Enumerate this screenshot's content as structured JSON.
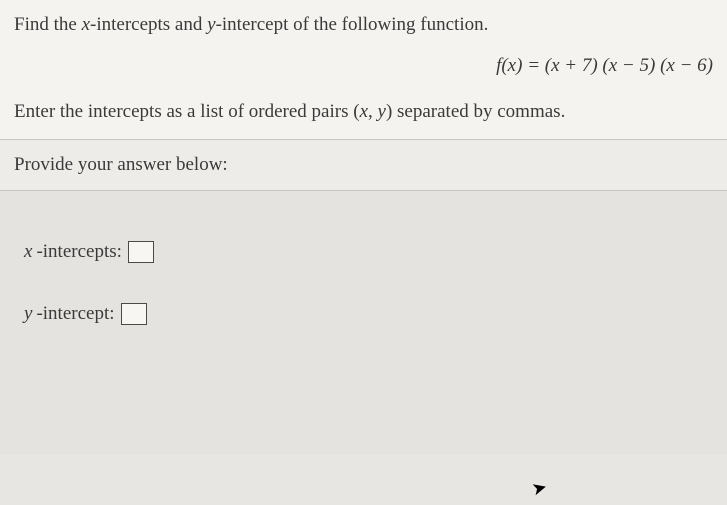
{
  "question": {
    "prompt_prefix": "Find the ",
    "x_var": "x",
    "prompt_mid1": "-intercepts and ",
    "y_var": "y",
    "prompt_mid2": "-intercept of the following function.",
    "equation_lhs": "f(x) = ",
    "equation_rhs": "(x + 7) (x − 5) (x − 6)",
    "instruction_prefix": "Enter the intercepts as a list of ordered pairs (",
    "pair_x": "x",
    "pair_sep": ", ",
    "pair_y": "y",
    "instruction_suffix": ") separated by commas."
  },
  "answer": {
    "header": "Provide your answer below:",
    "x_label_var": "x",
    "x_label_text": " -intercepts:",
    "y_label_var": "y",
    "y_label_text": " -intercept:",
    "x_value": "",
    "y_value": ""
  }
}
